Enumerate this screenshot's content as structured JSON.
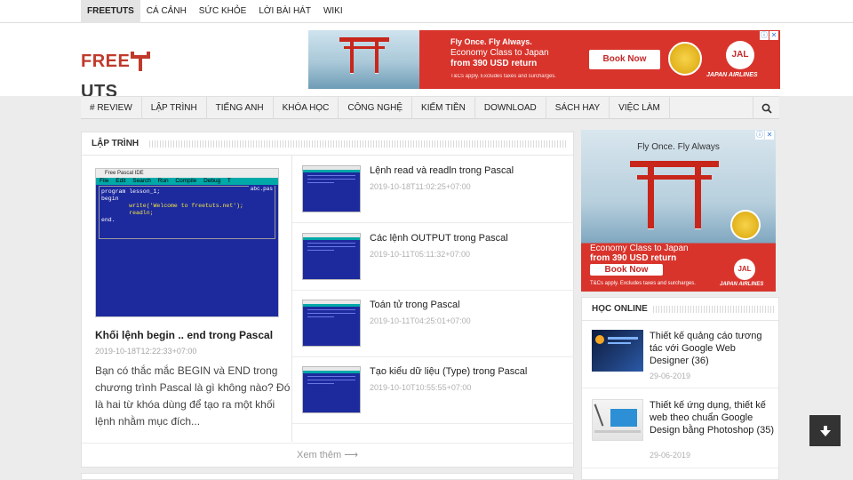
{
  "topbar": {
    "links": [
      "FREETUTS",
      "CÁ CẢNH",
      "SỨC KHỎE",
      "LỜI BÀI HÁT",
      "WIKI"
    ]
  },
  "logo": {
    "left": "FREE",
    "right": "UTS"
  },
  "ad_top": {
    "tagline": "Fly Once. Fly Always.",
    "line1": "Economy Class to Japan",
    "line2": "from 390 USD return",
    "fine": "T&Cs apply. Excludes taxes and surcharges.",
    "book": "Book Now",
    "brand": "JAPAN AIRLINES",
    "jal": "JAL"
  },
  "nav": {
    "items": [
      "# REVIEW",
      "LẬP TRÌNH",
      "TIẾNG ANH",
      "KHÓA HỌC",
      "CÔNG NGHỆ",
      "KIẾM TIỀN",
      "DOWNLOAD",
      "SÁCH HAY",
      "VIỆC LÀM"
    ]
  },
  "main": {
    "title": "LẬP TRÌNH",
    "feature": {
      "ide_title": "Free Pascal IDE",
      "ide_menu": "File Edit Search Run Compile Debug T",
      "ide_file": "abc.pas",
      "code_1": "program lesson_1;",
      "code_2": "begin",
      "code_3": "        write('Welcome to freetuts.net');",
      "code_4": "        readln;",
      "code_5": "end.",
      "title": "Khối lệnh begin .. end trong Pascal",
      "date": "2019-10-18T12:22:33+07:00",
      "desc": "Bạn có thắc mắc BEGIN và END trong chương trình Pascal là gì không nào? Đó là hai từ khóa dùng để tạo ra một khối lệnh nhằm mục đích..."
    },
    "posts": [
      {
        "title": "Lệnh read và readln trong Pascal",
        "date": "2019-10-18T11:02:25+07:00"
      },
      {
        "title": "Các lệnh OUTPUT trong Pascal",
        "date": "2019-10-11T05:11:32+07:00"
      },
      {
        "title": "Toán tử trong Pascal",
        "date": "2019-10-11T04:25:01+07:00"
      },
      {
        "title": "Tạo kiểu dữ liệu (Type) trong Pascal",
        "date": "2019-10-10T10:55:55+07:00"
      }
    ],
    "more": "Xem thêm ⟶"
  },
  "ad_side": {
    "tagline": "Fly Once. Fly Always",
    "line1": "Economy Class to Japan",
    "line2": "from 390 USD return",
    "book": "Book Now",
    "fine": "T&Cs apply. Excludes taxes and surcharges.",
    "brand": "JAPAN AIRLINES",
    "jal": "JAL"
  },
  "side": {
    "title": "HỌC ONLINE",
    "items": [
      {
        "title": "Thiết kế quảng cáo tương tác với Google Web Designer (36)",
        "date": "29-06-2019"
      },
      {
        "title": "Thiết kế ứng dụng, thiết kế web theo chuẩn Google Design bằng Photoshop (35)",
        "date": "29-06-2019"
      }
    ]
  },
  "colors": {
    "brand_red": "#c0392b",
    "ad_red": "#d8342c",
    "ide_blue": "#1d2a9e"
  }
}
